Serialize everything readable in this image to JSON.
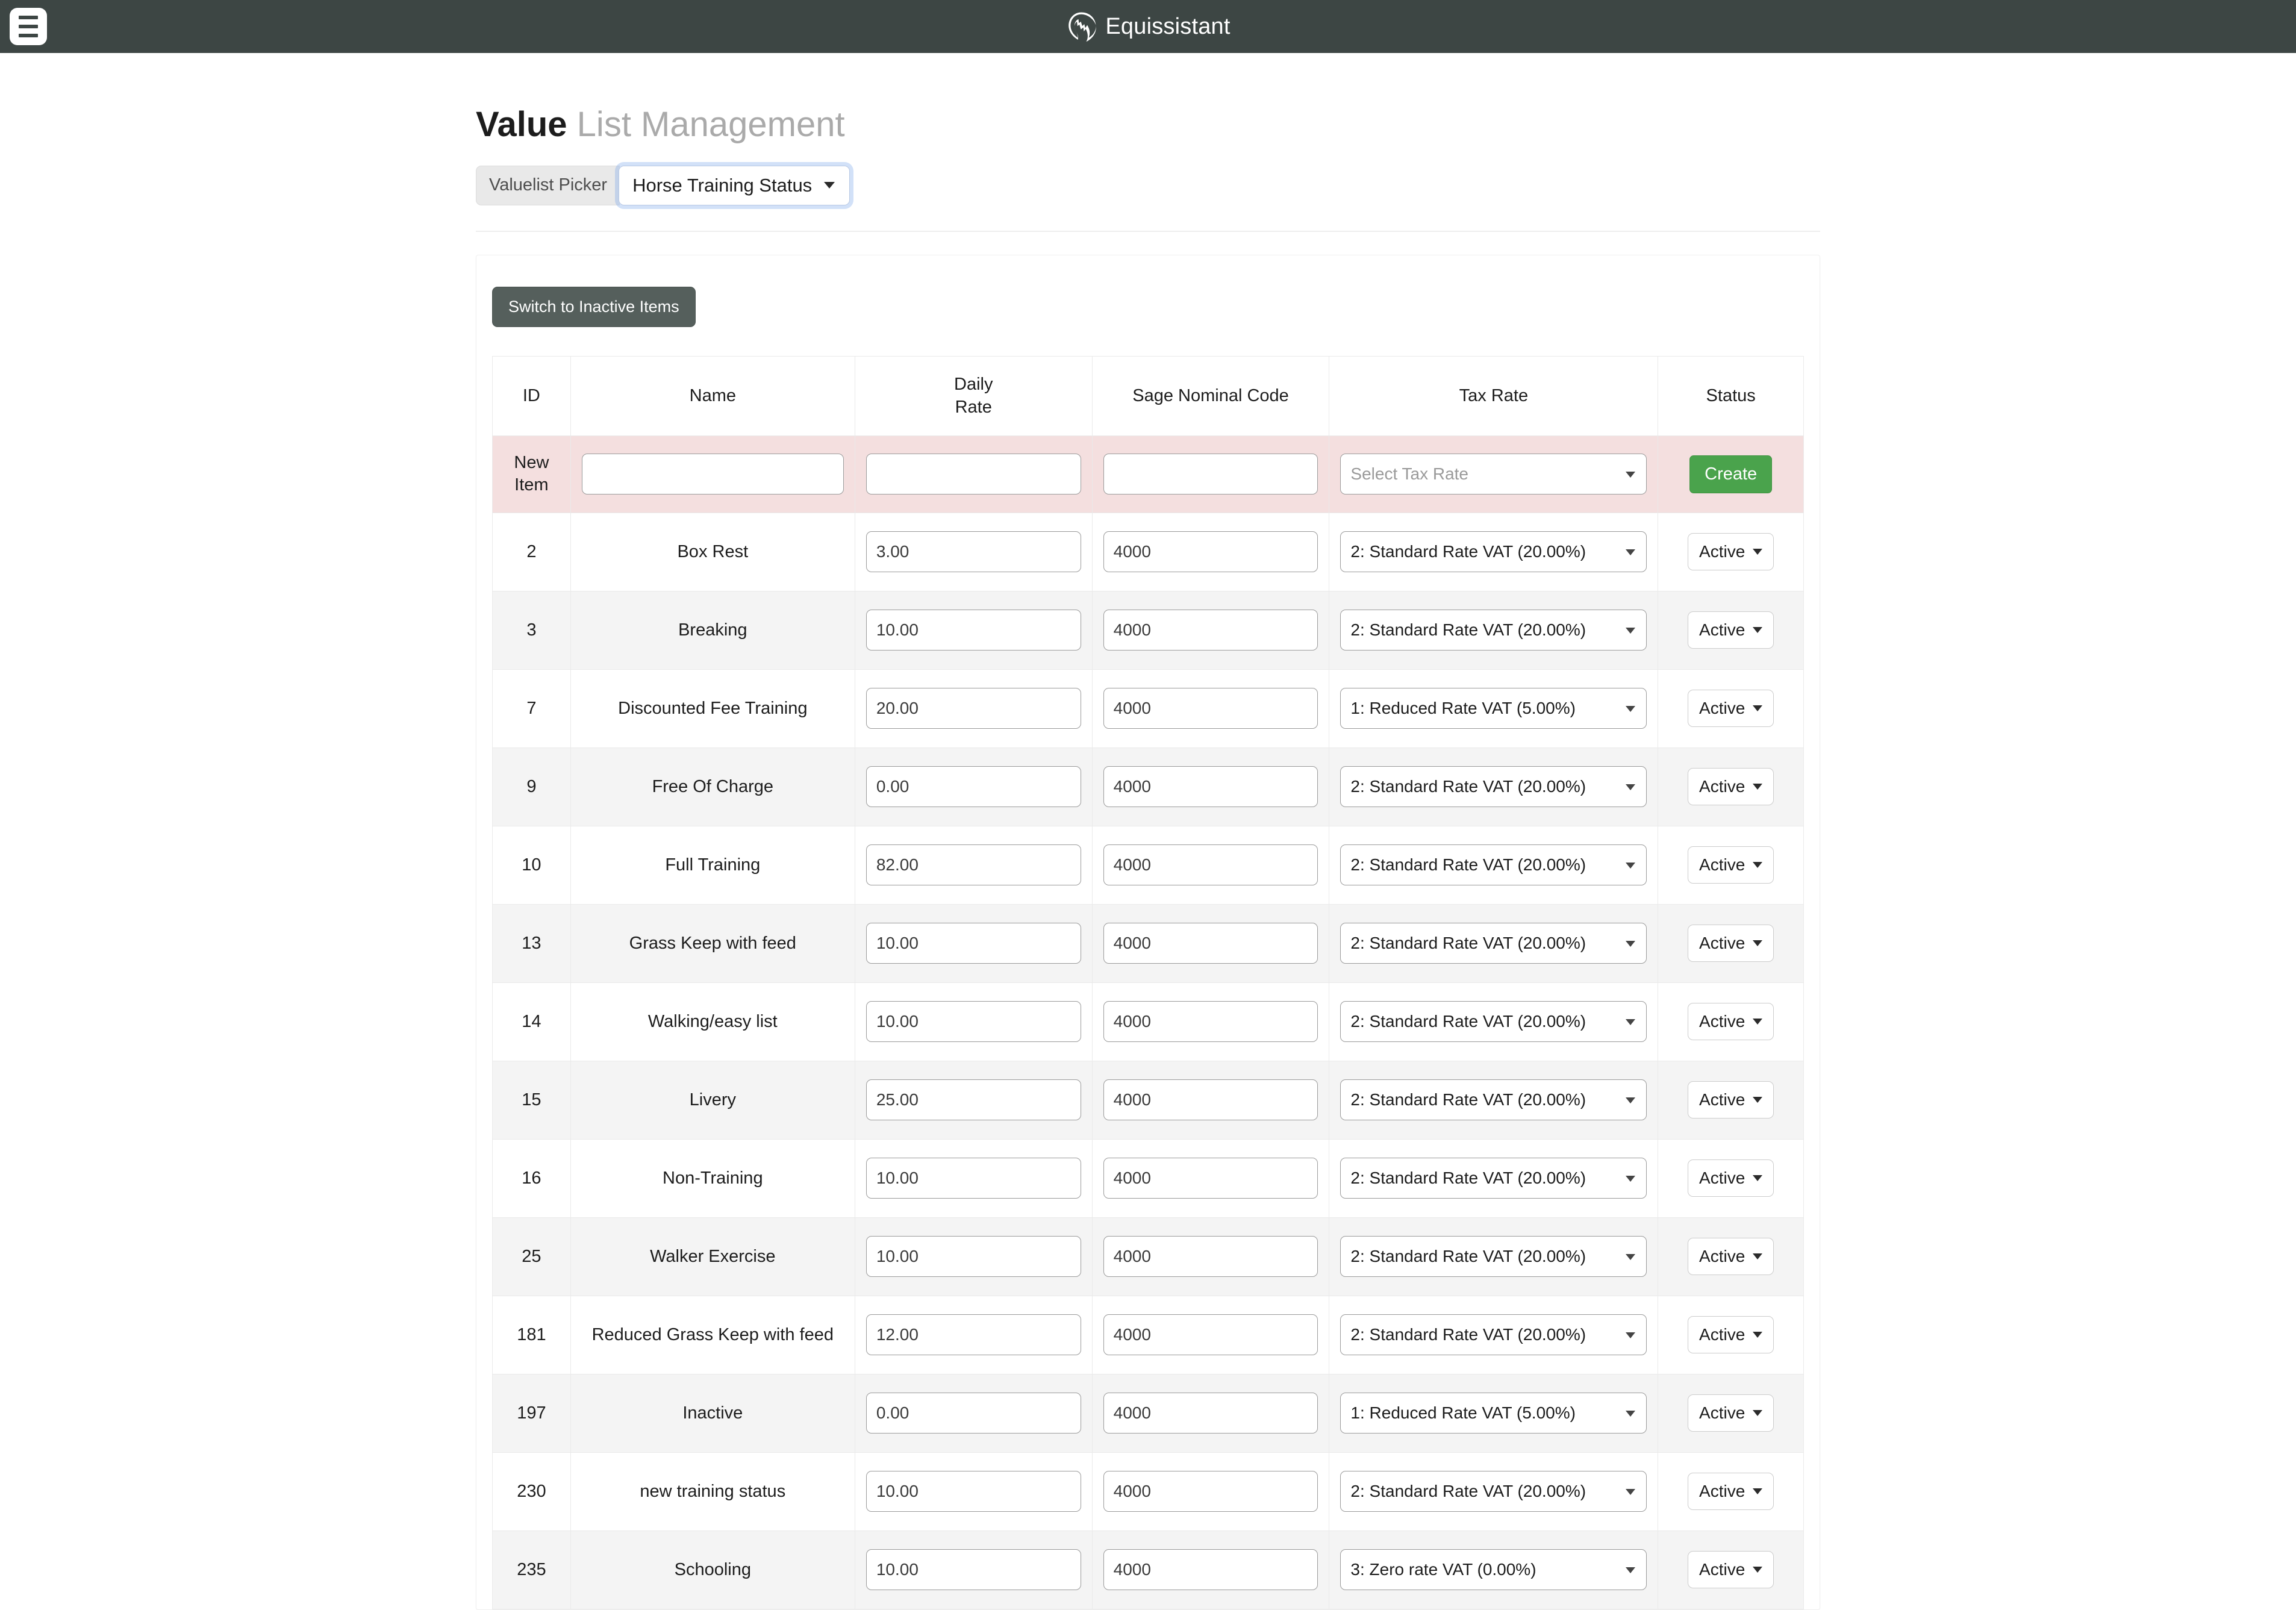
{
  "navbar": {
    "menu_icon": "hamburger-menu-icon",
    "logo_icon": "horse-head-logo-icon",
    "brand_name": "Equissistant",
    "background_color": "#3d4644"
  },
  "page": {
    "title_bold": "Value",
    "title_light": "List Management"
  },
  "picker": {
    "label": "Valuelist Picker",
    "selected": "Horse Training Status",
    "caret_icon": "chevron-down-icon"
  },
  "toolbar": {
    "switch_label": "Switch to Inactive Items"
  },
  "table": {
    "columns": [
      {
        "key": "id",
        "label": "ID"
      },
      {
        "key": "name",
        "label": "Name"
      },
      {
        "key": "rate",
        "label_line1": "Daily",
        "label_line2": "Rate"
      },
      {
        "key": "sage",
        "label": "Sage Nominal Code"
      },
      {
        "key": "tax",
        "label": "Tax Rate"
      },
      {
        "key": "status",
        "label": "Status"
      }
    ],
    "new_row": {
      "label_line1": "New",
      "label_line2": "Item",
      "name_value": "",
      "name_placeholder": "",
      "rate_value": "",
      "rate_placeholder": "",
      "sage_value": "",
      "sage_placeholder": "",
      "tax_placeholder": "Select Tax Rate",
      "create_label": "Create",
      "create_color": "#4aa34c",
      "row_color": "#f4dfdf"
    },
    "status_caret_icon": "chevron-down-icon",
    "rows": [
      {
        "id": "2",
        "name": "Box Rest",
        "rate": "3.00",
        "sage": "4000",
        "tax": "2: Standard Rate VAT (20.00%)",
        "status": "Active"
      },
      {
        "id": "3",
        "name": "Breaking",
        "rate": "10.00",
        "sage": "4000",
        "tax": "2: Standard Rate VAT (20.00%)",
        "status": "Active"
      },
      {
        "id": "7",
        "name": "Discounted Fee Training",
        "rate": "20.00",
        "sage": "4000",
        "tax": "1: Reduced Rate VAT (5.00%)",
        "status": "Active"
      },
      {
        "id": "9",
        "name": "Free Of Charge",
        "rate": "0.00",
        "sage": "4000",
        "tax": "2: Standard Rate VAT (20.00%)",
        "status": "Active"
      },
      {
        "id": "10",
        "name": "Full Training",
        "rate": "82.00",
        "sage": "4000",
        "tax": "2: Standard Rate VAT (20.00%)",
        "status": "Active"
      },
      {
        "id": "13",
        "name": "Grass Keep with feed",
        "rate": "10.00",
        "sage": "4000",
        "tax": "2: Standard Rate VAT (20.00%)",
        "status": "Active"
      },
      {
        "id": "14",
        "name": "Walking/easy list",
        "rate": "10.00",
        "sage": "4000",
        "tax": "2: Standard Rate VAT (20.00%)",
        "status": "Active"
      },
      {
        "id": "15",
        "name": "Livery",
        "rate": "25.00",
        "sage": "4000",
        "tax": "2: Standard Rate VAT (20.00%)",
        "status": "Active"
      },
      {
        "id": "16",
        "name": "Non-Training",
        "rate": "10.00",
        "sage": "4000",
        "tax": "2: Standard Rate VAT (20.00%)",
        "status": "Active"
      },
      {
        "id": "25",
        "name": "Walker Exercise",
        "rate": "10.00",
        "sage": "4000",
        "tax": "2: Standard Rate VAT (20.00%)",
        "status": "Active"
      },
      {
        "id": "181",
        "name": "Reduced Grass Keep with feed",
        "rate": "12.00",
        "sage": "4000",
        "tax": "2: Standard Rate VAT (20.00%)",
        "status": "Active"
      },
      {
        "id": "197",
        "name": "Inactive",
        "rate": "0.00",
        "sage": "4000",
        "tax": "1: Reduced Rate VAT (5.00%)",
        "status": "Active"
      },
      {
        "id": "230",
        "name": "new training status",
        "rate": "10.00",
        "sage": "4000",
        "tax": "2: Standard Rate VAT (20.00%)",
        "status": "Active"
      },
      {
        "id": "235",
        "name": "Schooling",
        "rate": "10.00",
        "sage": "4000",
        "tax": "3: Zero rate VAT (0.00%)",
        "status": "Active"
      }
    ]
  }
}
